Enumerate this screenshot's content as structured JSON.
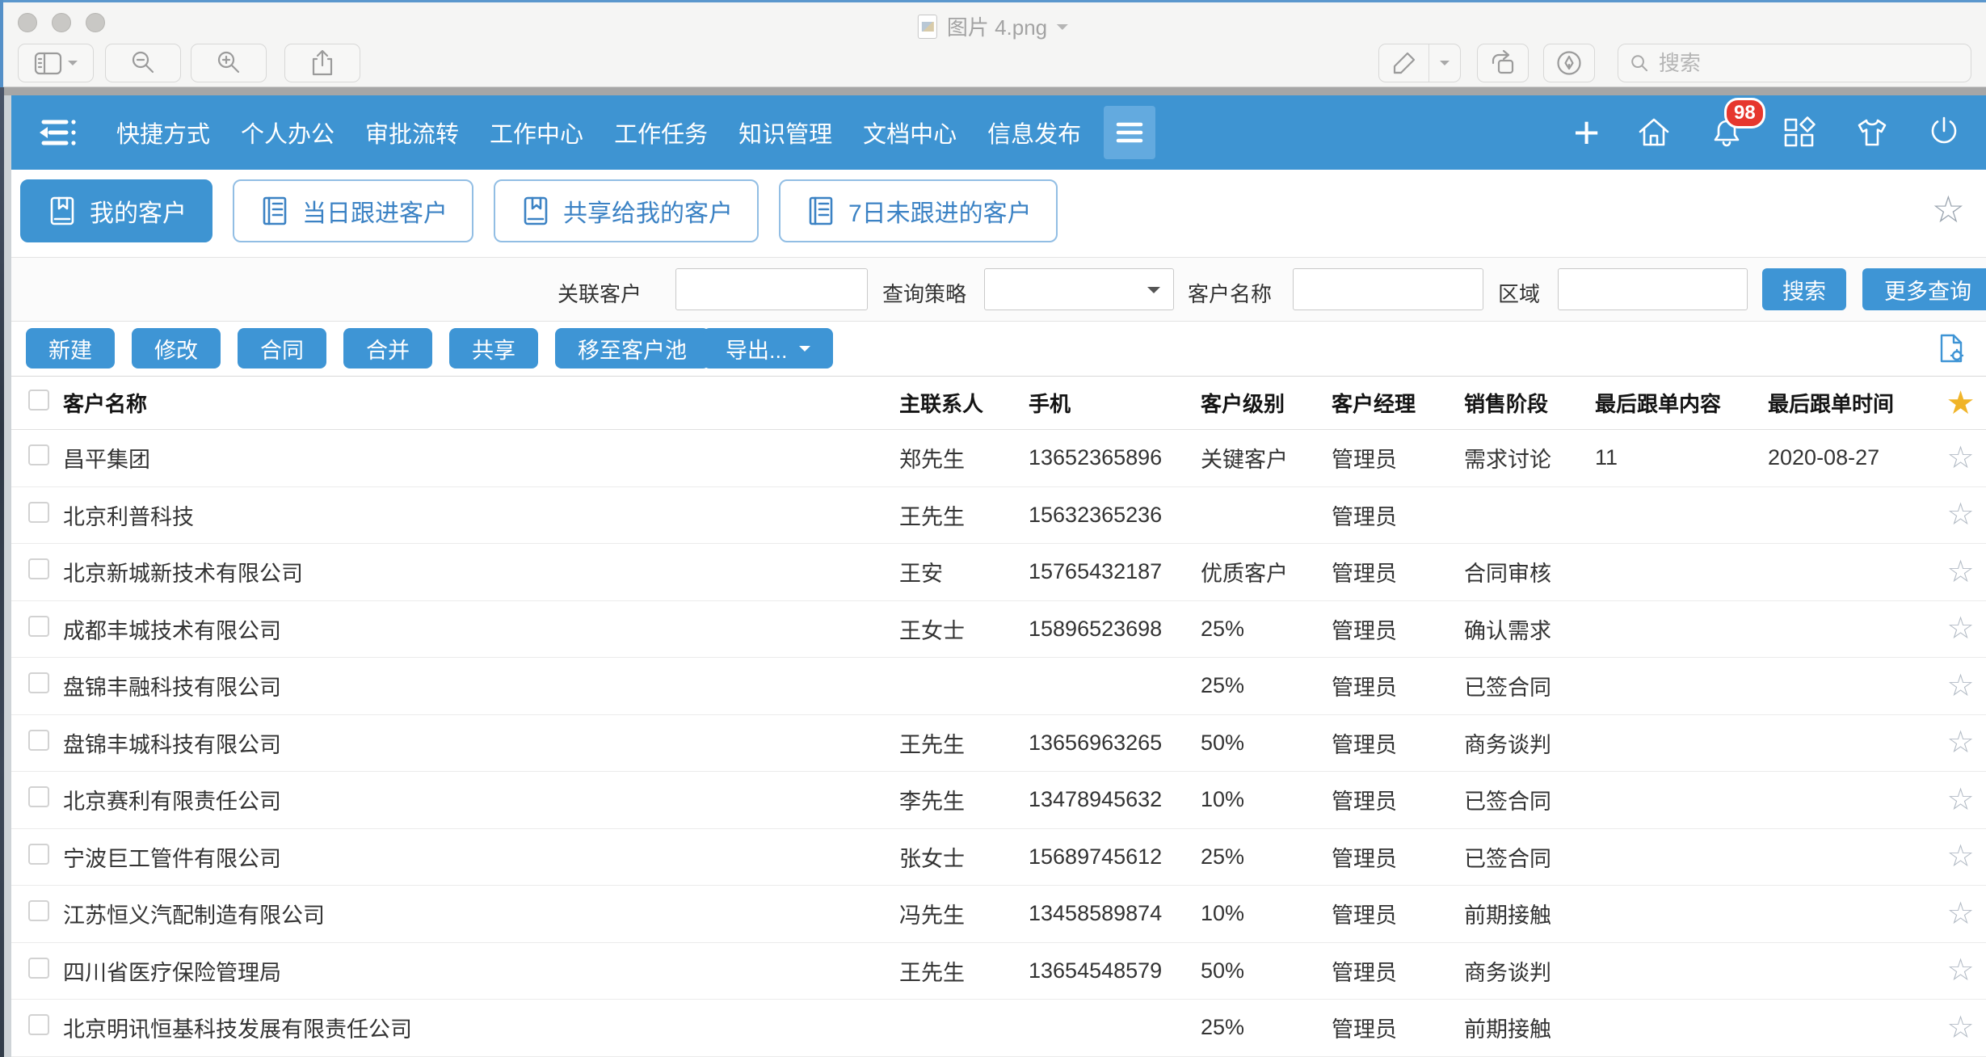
{
  "colors": {
    "nav_blue": "#3e94d2",
    "button_blue": "#3e95d5",
    "badge_red": "#e6372e",
    "star_gold": "#f0b429"
  },
  "preview": {
    "window_title": "图片 4.png",
    "search_placeholder": "搜索"
  },
  "nav": {
    "items": [
      "快捷方式",
      "个人办公",
      "审批流转",
      "工作中心",
      "工作任务",
      "知识管理",
      "文档中心",
      "信息发布"
    ],
    "notification_count": "98"
  },
  "tabs": [
    {
      "label": "我的客户",
      "icon": "book",
      "active": true
    },
    {
      "label": "当日跟进客户",
      "icon": "ledger"
    },
    {
      "label": "共享给我的客户",
      "icon": "book"
    },
    {
      "label": "7日未跟进的客户",
      "icon": "ledger"
    }
  ],
  "filters": {
    "related_label": "关联客户",
    "strategy_label": "查询策略",
    "name_label": "客户名称",
    "region_label": "区域",
    "search_button": "搜索",
    "more_button": "更多查询"
  },
  "toolbar": {
    "buttons": [
      "新建",
      "修改",
      "合同",
      "合并",
      "共享",
      "移至客户池"
    ],
    "export_button": "导出..."
  },
  "table": {
    "headers": [
      "客户名称",
      "主联系人",
      "手机",
      "客户级别",
      "客户经理",
      "销售阶段",
      "最后跟单内容",
      "最后跟单时间"
    ],
    "rows": [
      {
        "name": "昌平集团",
        "contact": "郑先生",
        "phone": "13652365896",
        "level": "关键客户",
        "manager": "管理员",
        "stage": "需求讨论",
        "note": "11",
        "time": "2020-08-27"
      },
      {
        "name": "北京利普科技",
        "contact": "王先生",
        "phone": "15632365236",
        "level": "",
        "manager": "管理员",
        "stage": "",
        "note": "",
        "time": ""
      },
      {
        "name": "北京新城新技术有限公司",
        "contact": "王安",
        "phone": "15765432187",
        "level": "优质客户",
        "manager": "管理员",
        "stage": "合同审核",
        "note": "",
        "time": ""
      },
      {
        "name": "成都丰城技术有限公司",
        "contact": "王女士",
        "phone": "15896523698",
        "level": "25%",
        "manager": "管理员",
        "stage": "确认需求",
        "note": "",
        "time": ""
      },
      {
        "name": "盘锦丰融科技有限公司",
        "contact": "",
        "phone": "",
        "level": "25%",
        "manager": "管理员",
        "stage": "已签合同",
        "note": "",
        "time": ""
      },
      {
        "name": "盘锦丰城科技有限公司",
        "contact": "王先生",
        "phone": "13656963265",
        "level": "50%",
        "manager": "管理员",
        "stage": "商务谈判",
        "note": "",
        "time": ""
      },
      {
        "name": "北京赛利有限责任公司",
        "contact": "李先生",
        "phone": "13478945632",
        "level": "10%",
        "manager": "管理员",
        "stage": "已签合同",
        "note": "",
        "time": ""
      },
      {
        "name": "宁波巨工管件有限公司",
        "contact": "张女士",
        "phone": "15689745612",
        "level": "25%",
        "manager": "管理员",
        "stage": "已签合同",
        "note": "",
        "time": ""
      },
      {
        "name": "江苏恒义汽配制造有限公司",
        "contact": "冯先生",
        "phone": "13458589874",
        "level": "10%",
        "manager": "管理员",
        "stage": "前期接触",
        "note": "",
        "time": ""
      },
      {
        "name": "四川省医疗保险管理局",
        "contact": "王先生",
        "phone": "13654548579",
        "level": "50%",
        "manager": "管理员",
        "stage": "商务谈判",
        "note": "",
        "time": ""
      },
      {
        "name": "北京明讯恒基科技发展有限责任公司",
        "contact": "",
        "phone": "",
        "level": "25%",
        "manager": "管理员",
        "stage": "前期接触",
        "note": "",
        "time": ""
      }
    ]
  }
}
